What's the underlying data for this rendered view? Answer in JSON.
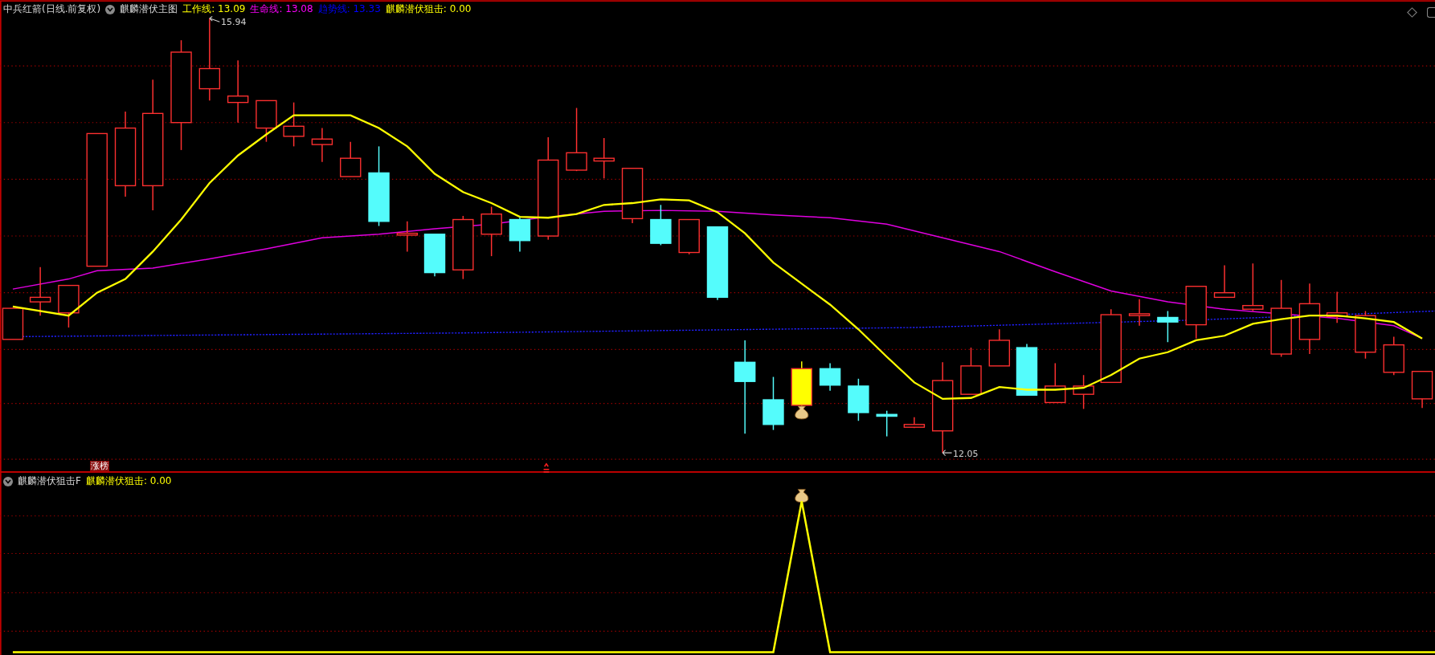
{
  "header": {
    "security": "中兵红箭(日线.前复权)",
    "indicator": "麒麟潜伏主图",
    "legend": [
      {
        "text": "工作线: 13.09",
        "color": "#ffff00"
      },
      {
        "text": "生命线: 13.08",
        "color": "#ff00ff"
      },
      {
        "text": "趋势线: 13.33",
        "color": "#0000ff"
      },
      {
        "text": "麒麟潜伏狙击: 0.00",
        "color": "#ffff00"
      }
    ]
  },
  "main_chart": {
    "high_label": "15.94",
    "low_label": "12.05",
    "tag": "涨榜"
  },
  "sub_panel": {
    "indicator": "麒麟潜伏狙击F",
    "legend": [
      {
        "text": "麒麟潜伏狙击: 0.00",
        "color": "#ffff00"
      }
    ]
  }
}
